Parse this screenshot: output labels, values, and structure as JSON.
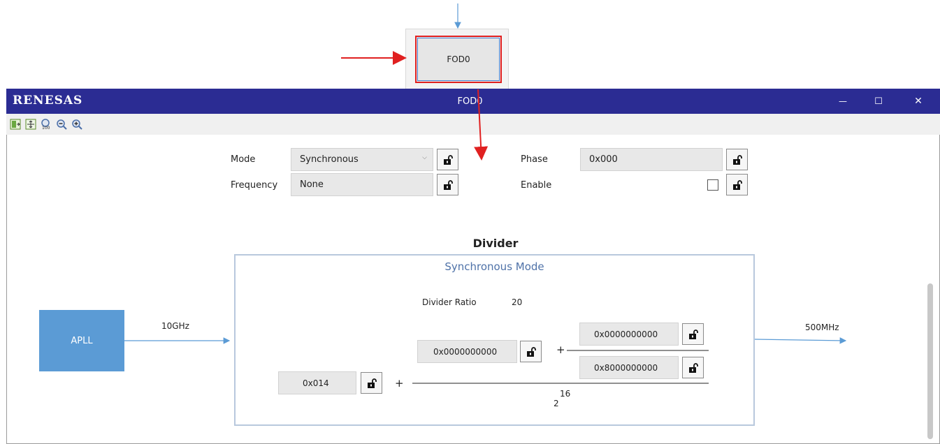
{
  "background": {
    "node_label": "FOD0"
  },
  "window": {
    "brand": "RENESAS",
    "title": "FOD0",
    "controls": {
      "minimize": "—",
      "maximize": "☐",
      "close": "✕"
    }
  },
  "toolbar": {
    "tools": [
      "fit-page-icon",
      "fit-window-icon",
      "zoom-100-icon",
      "zoom-out-icon",
      "zoom-in-icon"
    ]
  },
  "form": {
    "mode_label": "Mode",
    "mode_value": "Synchronous",
    "frequency_label": "Frequency",
    "frequency_value": "None",
    "phase_label": "Phase",
    "phase_value": "0x000",
    "enable_label": "Enable",
    "enable_checked": false
  },
  "divider": {
    "title": "Divider",
    "mode_title": "Synchronous Mode",
    "ratio_label": "Divider Ratio",
    "ratio_value": "20",
    "integer_value": "0x014",
    "fraction_value": "0x0000000000",
    "numerator_value": "0x0000000000",
    "denominator_value": "0x8000000000",
    "plus": "+",
    "base": "2",
    "exponent": "16"
  },
  "diagram": {
    "source_label": "APLL",
    "input_freq": "10GHz",
    "output_freq": "500MHz"
  },
  "colors": {
    "titlebar": "#2b2c93",
    "apll_block": "#5b9bd5",
    "annotation_arrow": "#e02020",
    "connector": "#5b9bd5"
  }
}
